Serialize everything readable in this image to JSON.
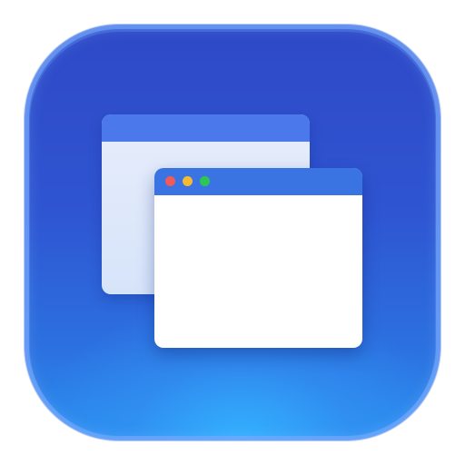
{
  "app_icon": {
    "icon": "windows-stack-icon",
    "colors": {
      "background_top": "#2f49c7",
      "background_bottom": "#2a8ef0",
      "glow": "#34b2ff",
      "back_window_titlebar": "#4b78ea",
      "back_window_body": "#e7edfb",
      "front_window_titlebar": "#3a74e3",
      "front_window_body": "#ffffff"
    },
    "traffic_lights": [
      {
        "name": "close",
        "color": "#f25a5a"
      },
      {
        "name": "minimize",
        "color": "#f7b92f"
      },
      {
        "name": "maximize",
        "color": "#2dc653"
      }
    ]
  }
}
